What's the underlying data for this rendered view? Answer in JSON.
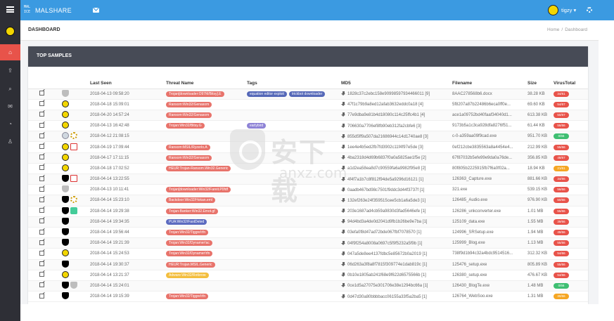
{
  "app": {
    "brand": "MALSHARE",
    "user": "tigzy"
  },
  "header": {
    "title": "DASHBOARD",
    "breadcrumbs": [
      "Home",
      "Dashboard"
    ]
  },
  "sidebar": {
    "items": [
      {
        "icon": "home-icon",
        "active": true
      },
      {
        "icon": "upload-icon",
        "active": false
      },
      {
        "icon": "search-icon",
        "active": false
      },
      {
        "icon": "chat-icon",
        "active": false
      },
      {
        "icon": "rss-icon",
        "active": false
      },
      {
        "icon": "user-icon",
        "active": false
      }
    ]
  },
  "card": {
    "title": "TOP SAMPLES",
    "columns": [
      "",
      "",
      "Last Seen",
      "Threat Name",
      "Tags",
      "MD5",
      "Filename",
      "Size",
      "VirusTotal"
    ]
  },
  "watermark": {
    "main": "安下载",
    "sub": "anxz.com"
  },
  "rows": [
    {
      "icons": [
        "gen"
      ],
      "last_seen": "2018-04-13 09:58:20",
      "threat": "Trojan[downloader:O97M/Bitsy].E",
      "threat_color": "red",
      "tags": [
        "equation editor exploit",
        "trickbot downloader"
      ],
      "md5": "1828c37c2ebc158e90998597934466011 [9]",
      "filename": "8AAC278568b6.docx",
      "size": "38.28 KB",
      "vt": "34/61",
      "vt_color": "red"
    },
    {
      "icons": [
        "bio"
      ],
      "last_seen": "2018-04-18 15:09:01",
      "threat": "Ransom:Win32/Genasom",
      "threat_color": "red",
      "tags": [],
      "md5": "47f1c79b9a8ed12afab3632eddc0a18 [4]",
      "filename": "5f8207a87b22486b6eca0ff0e...",
      "size": "69.60 KB",
      "vt": "54/67",
      "vt_color": "red"
    },
    {
      "icons": [
        "bio"
      ],
      "last_seen": "2018-04-20 14:57:24",
      "threat": "Ransom:Win32/Genasom",
      "threat_color": "red",
      "tags": [],
      "md5": "77e9dba9e81b4d18080c114c25ffc4b1 [4]",
      "filename": "ace1a09752bd40faaf34040d1...",
      "size": "613.38 KB",
      "vt": "50/67",
      "vt_color": "red"
    },
    {
      "icons": [
        "bio"
      ],
      "last_seen": "2018-04-13 16:42:48",
      "threat": "Trojan:Win32/Bitsy.G",
      "threat_color": "red",
      "tags": [
        "earlybird"
      ],
      "md5": "706630a7706ef8fb90eb312fa2cbfe6 [3]",
      "filename": "9173b5a1c3ca928dfa8276f51...",
      "size": "61.44 KB",
      "vt": "56/66",
      "vt_color": "red"
    },
    {
      "icons": [
        "cd",
        "gear"
      ],
      "last_seen": "2018-04-12 21:08:15",
      "threat": "",
      "threat_color": "",
      "tags": [],
      "md5": "855d5ff9a507da21686944c14d1740ae8 [3]",
      "filename": "c-0-a359aa09f9cad.exe",
      "size": "951.70 KB",
      "vt": "0/66",
      "vt_color": "green"
    },
    {
      "icons": [
        "bio",
        "pdf"
      ],
      "last_seen": "2018-04-19 17:09:44",
      "threat": "Ransom:MSIL/Ryzerlo.A",
      "threat_color": "red",
      "tags": [],
      "md5": "1ee4e4b5ed2fb7fd3902c11f4f97e5de [3]",
      "filename": "0ef212cbe3835563a8a4454e4...",
      "size": "212.99 KB",
      "vt": "55/66",
      "vt_color": "red"
    },
    {
      "icons": [
        "bio"
      ],
      "last_seen": "2018-04-17 17:11:15",
      "threat": "Ransom:Win32/Genasom",
      "threat_color": "red",
      "tags": [],
      "md5": "4ba2318d4d69b6837f0a0a5825ae1f5e [2]",
      "filename": "67f87032b5efe99e9da0a76de...",
      "size": "356.85 KB",
      "vt": "48/67",
      "vt_color": "red"
    },
    {
      "icons": [
        "bio"
      ],
      "last_seen": "2018-04-18 17:02:52",
      "threat": "HEUR:Trojan-Ransom.Win32.Generic",
      "threat_color": "red",
      "tags": [],
      "md5": "a1d2ea58ea8d7c90559fa6a9982f95e8 [2]",
      "filename": "80f805b2225915fb7f6a0f02a...",
      "size": "18.94 KB",
      "vt": "21/61",
      "vt_color": "orange"
    },
    {
      "icons": [
        "pkg",
        "pdf"
      ],
      "last_seen": "2018-04-14 13:22:55",
      "threat": "",
      "threat_color": "",
      "tags": [],
      "md5": "4f4f7a1b7c8f812f94de5a9296d16121 [1]",
      "filename": "126363_Capture.exe",
      "size": "881.66 KB",
      "vt": "34/66",
      "vt_color": "red"
    },
    {
      "icons": [
        "gen"
      ],
      "last_seen": "2018-04-13 10:11:41",
      "threat": "Trojan[downloader:Win32/Fareit.P0fdf",
      "threat_color": "red",
      "tags": [],
      "md5": "0aadb467bd98c7501f9ddc3d44f3737f [1]",
      "filename": "321.exe",
      "size": "539.15 KB",
      "vt": "56/66",
      "vt_color": "red"
    },
    {
      "icons": [
        "pkg",
        "gear"
      ],
      "last_seen": "2018-04-14 15:23:10",
      "threat": "Backdoor:Win32/Hokan.eml",
      "threat_color": "red",
      "tags": [],
      "md5": "132ef263e24f359515cee5cb1a6a5de3 [1]",
      "filename": "126485_Audio.exe",
      "size": "976.90 KB",
      "vt": "50/66",
      "vt_color": "red"
    },
    {
      "icons": [
        "pkg",
        "exe"
      ],
      "last_seen": "2018-04-14 19:29:38",
      "threat": "Trojan-Banker:Win32.Emot.gf",
      "threat_color": "red",
      "tags": [],
      "md5": "203e1687ad4cb59a9830d3fad5646efe [1]",
      "filename": "126286_unkconverter.exe",
      "size": "1.01 MB",
      "vt": "55/66",
      "vt_color": "red"
    },
    {
      "icons": [
        "pkg"
      ],
      "last_seen": "2018-04-14 19:34:35",
      "threat": "PUA:Win32/FastDeted",
      "threat_color": "blue",
      "tags": [],
      "md5": "94d4bd3a4de0d2041d9fb1b26be9e7ba [1]",
      "filename": "125109_data.exe",
      "size": "1.55 MB",
      "vt": "39/66",
      "vt_color": "red"
    },
    {
      "icons": [
        "pkg"
      ],
      "last_seen": "2018-04-14 19:56:44",
      "threat": "Trojan:Win32/Tiggre!rfn",
      "threat_color": "red",
      "tags": [],
      "md5": "03efa0f8d47ad72bde067fbf7078570 [1]",
      "filename": "124996_SRSetup.exe",
      "size": "1.94 MB",
      "vt": "49/66",
      "vt_color": "red"
    },
    {
      "icons": [
        "pkg"
      ],
      "last_seen": "2018-04-14 19:21:39",
      "threat": "Trojan:Win32/Dynamer!ac",
      "threat_color": "red",
      "tags": [],
      "md5": "04f9f254a8008a0697c5f9f5232a5f9b [1]",
      "filename": "125999_Blog.exe",
      "size": "1.13 MB",
      "vt": "55/66",
      "vt_color": "red"
    },
    {
      "icons": [
        "bio"
      ],
      "last_seen": "2018-04-14 15:24:53",
      "threat": "Trojan:Win32/Dynamer!rfn",
      "threat_color": "red",
      "tags": [],
      "md5": "047a5de8ee4137fdbc5e85672b0a2019 [1]",
      "filename": "738f9d1b94c32a4bdc9514516...",
      "size": "312.32 KB",
      "vt": "54/66",
      "vt_color": "red"
    },
    {
      "icons": [
        "pkg"
      ],
      "last_seen": "2018-04-14 19:30:37",
      "threat": "HEUR:Trojan.MSIL.Generic",
      "threat_color": "red",
      "tags": [],
      "md5": "06d263a3f8a8f7815f309774e1dab819c [1]",
      "filename": "125476_setup.exe",
      "size": "805.89 KB",
      "vt": "55/66",
      "vt_color": "red"
    },
    {
      "icons": [
        "bio"
      ],
      "last_seen": "2018-04-14 13:21:37",
      "threat": "Adware:Win32/Rotbrow",
      "threat_color": "yellow",
      "tags": [],
      "md5": "0b10e1805ab241f68e9f622d6575566b [1]",
      "filename": "126380_setup.exe",
      "size": "476.67 KB",
      "vt": "54/66",
      "vt_color": "red"
    },
    {
      "icons": [
        "pkg",
        "gen"
      ],
      "last_seen": "2018-04-14 15:24:01",
      "threat": "",
      "threat_color": "",
      "tags": [],
      "md5": "0ce1d5a27075e301706e38e1294bc66a [1]",
      "filename": "126430_BlogTe.exe",
      "size": "1.48 MB",
      "vt": "0/66",
      "vt_color": "green"
    },
    {
      "icons": [
        "pkg"
      ],
      "last_seen": "2018-04-14 19:15:39",
      "threat": "Trojan:Win32/Tiggre!rfn",
      "threat_color": "red",
      "tags": [],
      "md5": "0d47d30a80bbbbacc06155a33f5a2ba5 [1]",
      "filename": "126764_WebSoo.exe",
      "size": "1.31 MB",
      "vt": "30/66",
      "vt_color": "orange"
    }
  ]
}
